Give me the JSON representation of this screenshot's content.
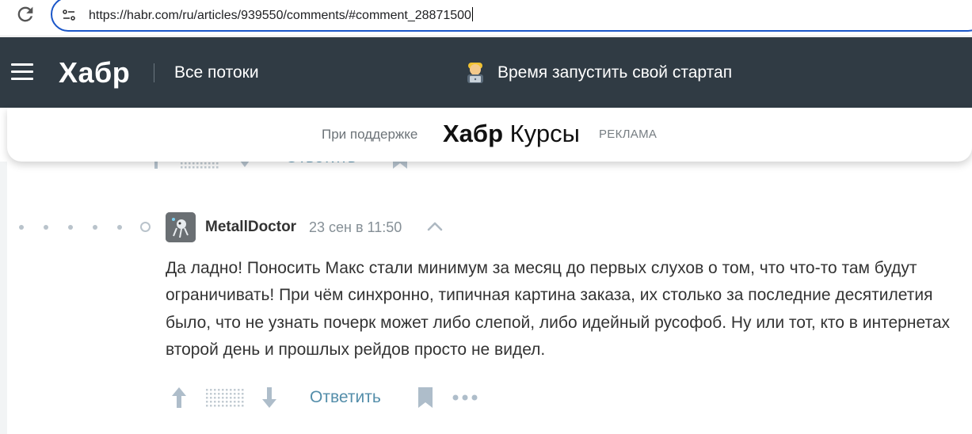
{
  "browser": {
    "url": "https://habr.com/ru/articles/939550/comments/#comment_28871500"
  },
  "header": {
    "logo": "Хабр",
    "nav_label": "Все потоки",
    "promo_text": "Время запустить свой стартап"
  },
  "sponsor": {
    "support_text": "При поддержке",
    "brand_bold": "Хабр",
    "brand_regular": " Курсы",
    "ad_label": "РЕКЛАМА"
  },
  "comment": {
    "author": "MetallDoctor",
    "time": "23 сен в 11:50",
    "text": "Да ладно! Поносить Макс стали минимум за месяц до первых слухов о том, что что-то там будут ограничивать! При чём синхронно, типичная картина заказа, их столько за последние десятилетия было, что не узнать почерк может либо слепой, либо идейный русофоб. Ну или тот, кто в интернетах второй день и прошлых рейдов просто не видел.",
    "reply_label": "Ответить",
    "nesting_level": 6
  },
  "prev_comment": {
    "reply_label": "Ответить"
  },
  "colors": {
    "header_bg": "#303b44",
    "link": "#548eaa",
    "url_focus": "#1a56c8"
  }
}
